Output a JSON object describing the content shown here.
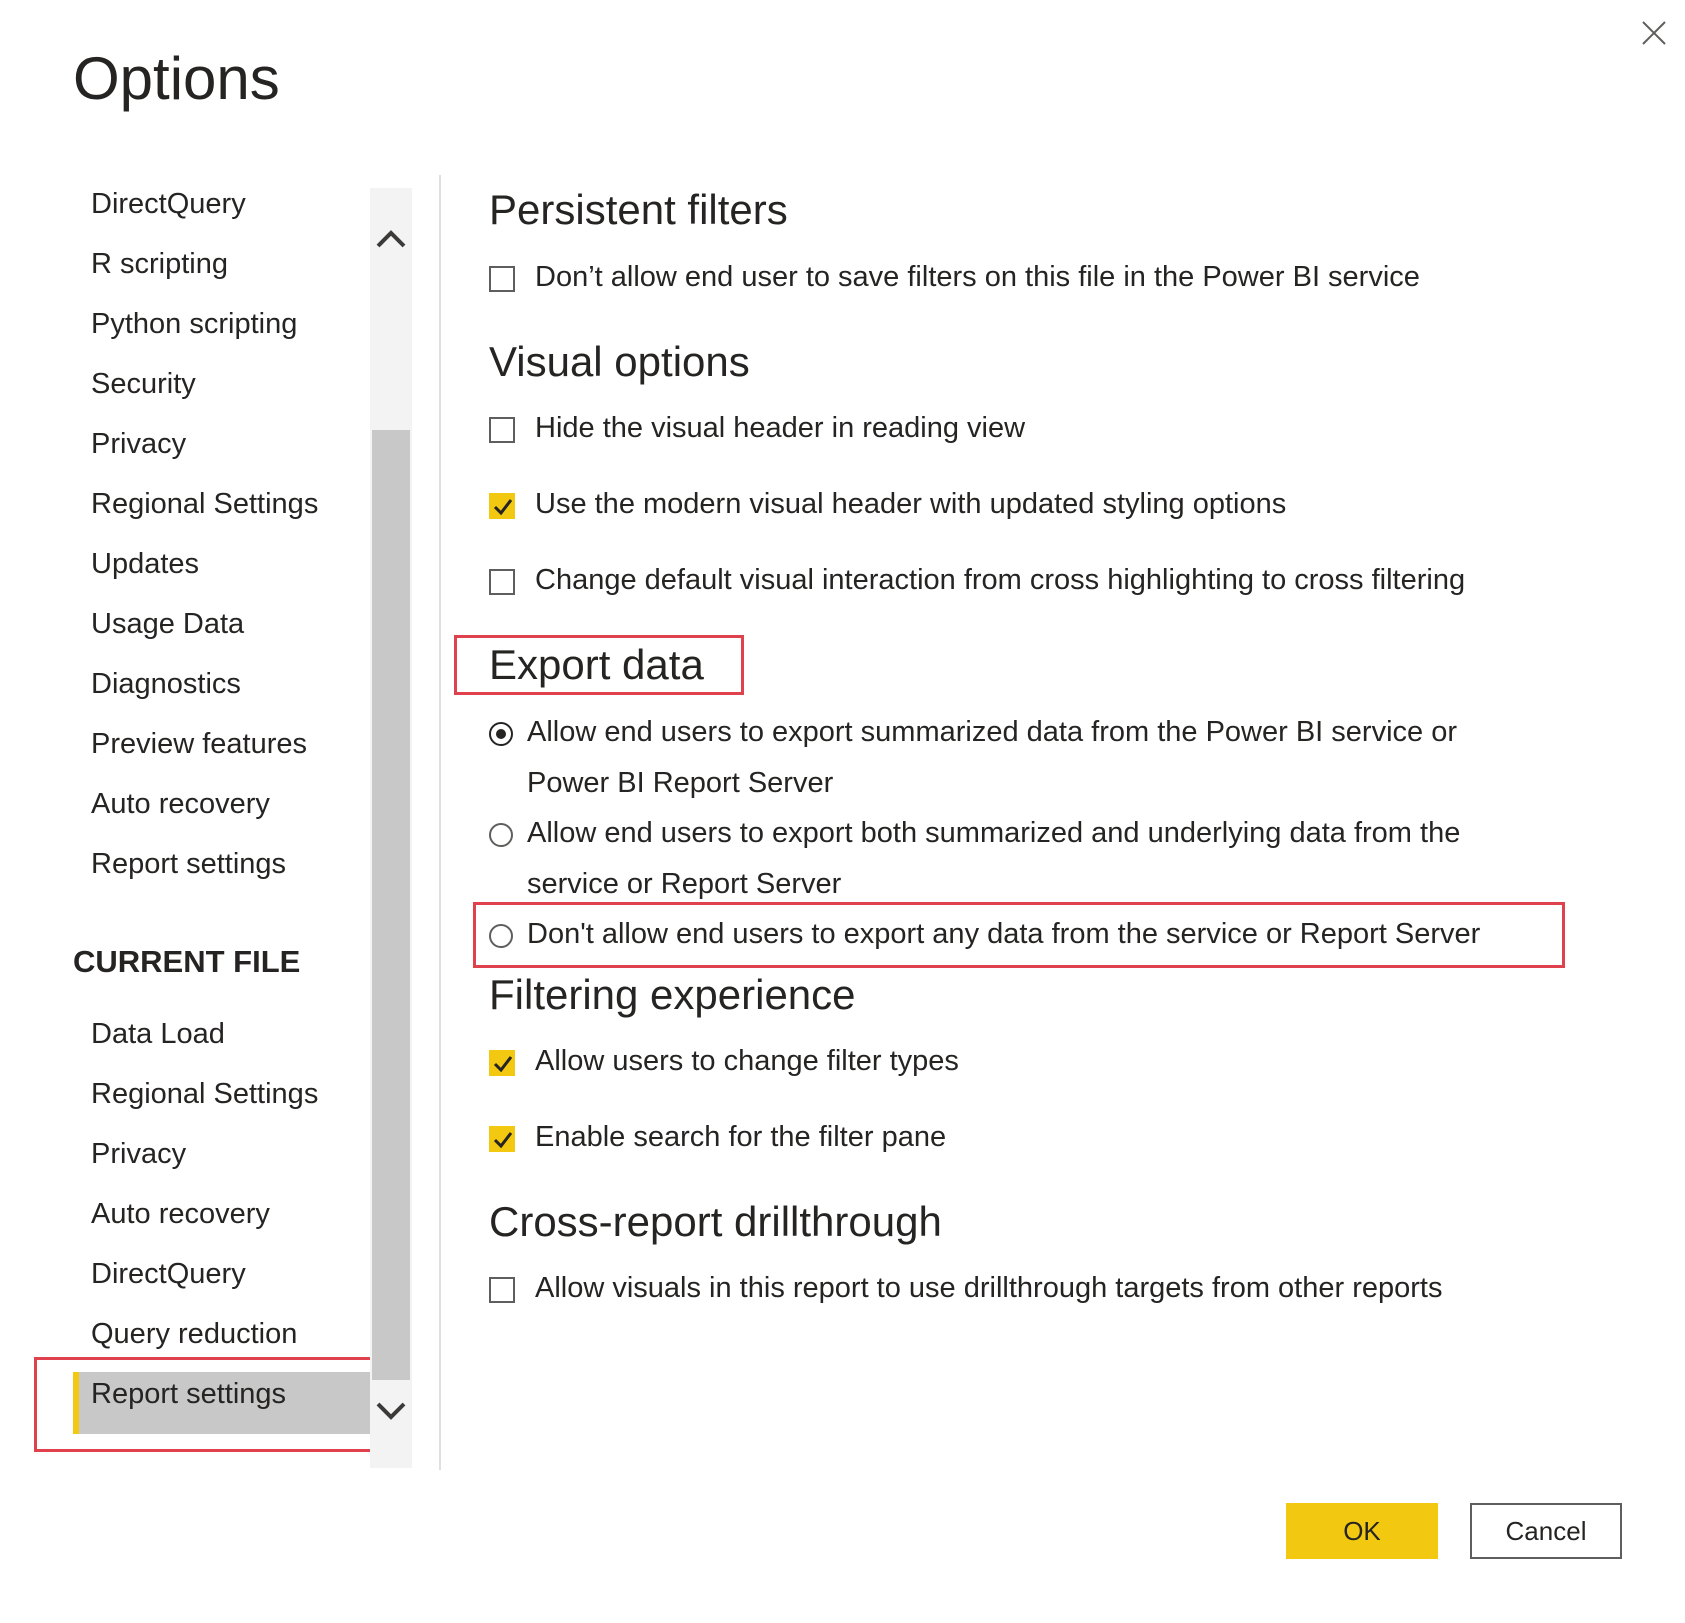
{
  "dialog": {
    "title": "Options"
  },
  "nav": {
    "global_items": [
      "DirectQuery",
      "R scripting",
      "Python scripting",
      "Security",
      "Privacy",
      "Regional Settings",
      "Updates",
      "Usage Data",
      "Diagnostics",
      "Preview features",
      "Auto recovery",
      "Report settings"
    ],
    "current_file_heading": "CURRENT FILE",
    "current_file_items": [
      "Data Load",
      "Regional Settings",
      "Privacy",
      "Auto recovery",
      "DirectQuery",
      "Query reduction",
      "Report settings"
    ],
    "selected": "Report settings"
  },
  "sections": {
    "persistent_filters": {
      "heading": "Persistent filters",
      "opt1": "Don’t allow end user to save filters on this file in the Power BI service"
    },
    "visual_options": {
      "heading": "Visual options",
      "opt1": "Hide the visual header in reading view",
      "opt2": "Use the modern visual header with updated styling options",
      "opt3": "Change default visual interaction from cross highlighting to cross filtering"
    },
    "export_data": {
      "heading": "Export data",
      "opt1": "Allow end users to export summarized data from the Power BI service or Power BI Report Server",
      "opt2": "Allow end users to export both summarized and underlying data from the service or Report Server",
      "opt3": "Don't allow end users to export any data from the service or Report Server"
    },
    "filtering_experience": {
      "heading": "Filtering experience",
      "opt1": "Allow users to change filter types",
      "opt2": "Enable search for the filter pane"
    },
    "cross_report": {
      "heading": "Cross-report drillthrough",
      "opt1": "Allow visuals in this report to use drillthrough targets from other reports"
    }
  },
  "buttons": {
    "ok": "OK",
    "cancel": "Cancel"
  },
  "colors": {
    "accent": "#f2c811",
    "highlight_box": "#e0424d",
    "selected_bg": "#c8c8c8"
  }
}
